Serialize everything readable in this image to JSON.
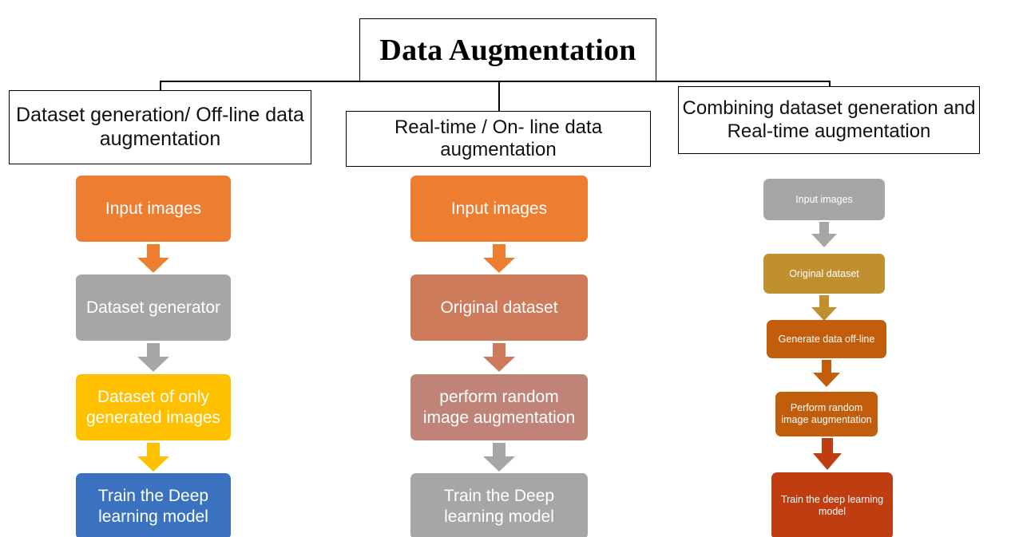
{
  "title": {
    "text": "Data Augmentation"
  },
  "colors": {
    "orange": "#ED7D31",
    "gray": "#A6A6A6",
    "gold": "#FFC000",
    "blue": "#3A72C0",
    "terracotta": "#CE7B5C",
    "dusty_rose": "#BF8378",
    "gray2": "#A6A6A6",
    "dark_gold": "#BF8F30",
    "dark_orange": "#C25E0B",
    "dark_red": "#BF3D11",
    "line": "#000000"
  },
  "headers": [
    {
      "id": "hdr-1",
      "label": "Dataset generation/ Off-line data augmentation"
    },
    {
      "id": "hdr-2",
      "label": "Real-time / On- line data augmentation"
    },
    {
      "id": "hdr-3",
      "label": "Combining dataset generation and Real-time augmentation"
    }
  ],
  "columns": [
    {
      "name": "offline-column",
      "nodes": [
        {
          "label": "Input images",
          "color": "#ED7D31"
        },
        {
          "label": "Dataset generator",
          "color": "#A6A6A6"
        },
        {
          "label": "Dataset of only generated images",
          "color": "#FFC000"
        },
        {
          "label": "Train the Deep learning model",
          "color": "#3A72C0"
        }
      ],
      "arrows": [
        {
          "color": "#ED7D31"
        },
        {
          "color": "#A6A6A6"
        },
        {
          "color": "#FFC000"
        }
      ]
    },
    {
      "name": "online-column",
      "nodes": [
        {
          "label": "Input images",
          "color": "#ED7D31"
        },
        {
          "label": "Original dataset",
          "color": "#CE7B5C"
        },
        {
          "label": "perform random image augmentation",
          "color": "#BF8378"
        },
        {
          "label": "Train the Deep learning model",
          "color": "#A6A6A6"
        }
      ],
      "arrows": [
        {
          "color": "#ED7D31"
        },
        {
          "color": "#CE7B5C"
        },
        {
          "color": "#A6A6A6"
        }
      ]
    },
    {
      "name": "combined-column",
      "nodes": [
        {
          "label": "Input images",
          "color": "#A6A6A6"
        },
        {
          "label": "Original dataset",
          "color": "#BF8F30"
        },
        {
          "label": "Generate data off-line",
          "color": "#C25E0B"
        },
        {
          "label": "Perform random image augmentation",
          "color": "#C25E0B"
        },
        {
          "label": "Train the deep learning model",
          "color": "#BF3D11"
        }
      ],
      "arrows": [
        {
          "color": "#A6A6A6"
        },
        {
          "color": "#BF8F30"
        },
        {
          "color": "#C25E0B"
        },
        {
          "color": "#BF3D11"
        }
      ]
    }
  ]
}
